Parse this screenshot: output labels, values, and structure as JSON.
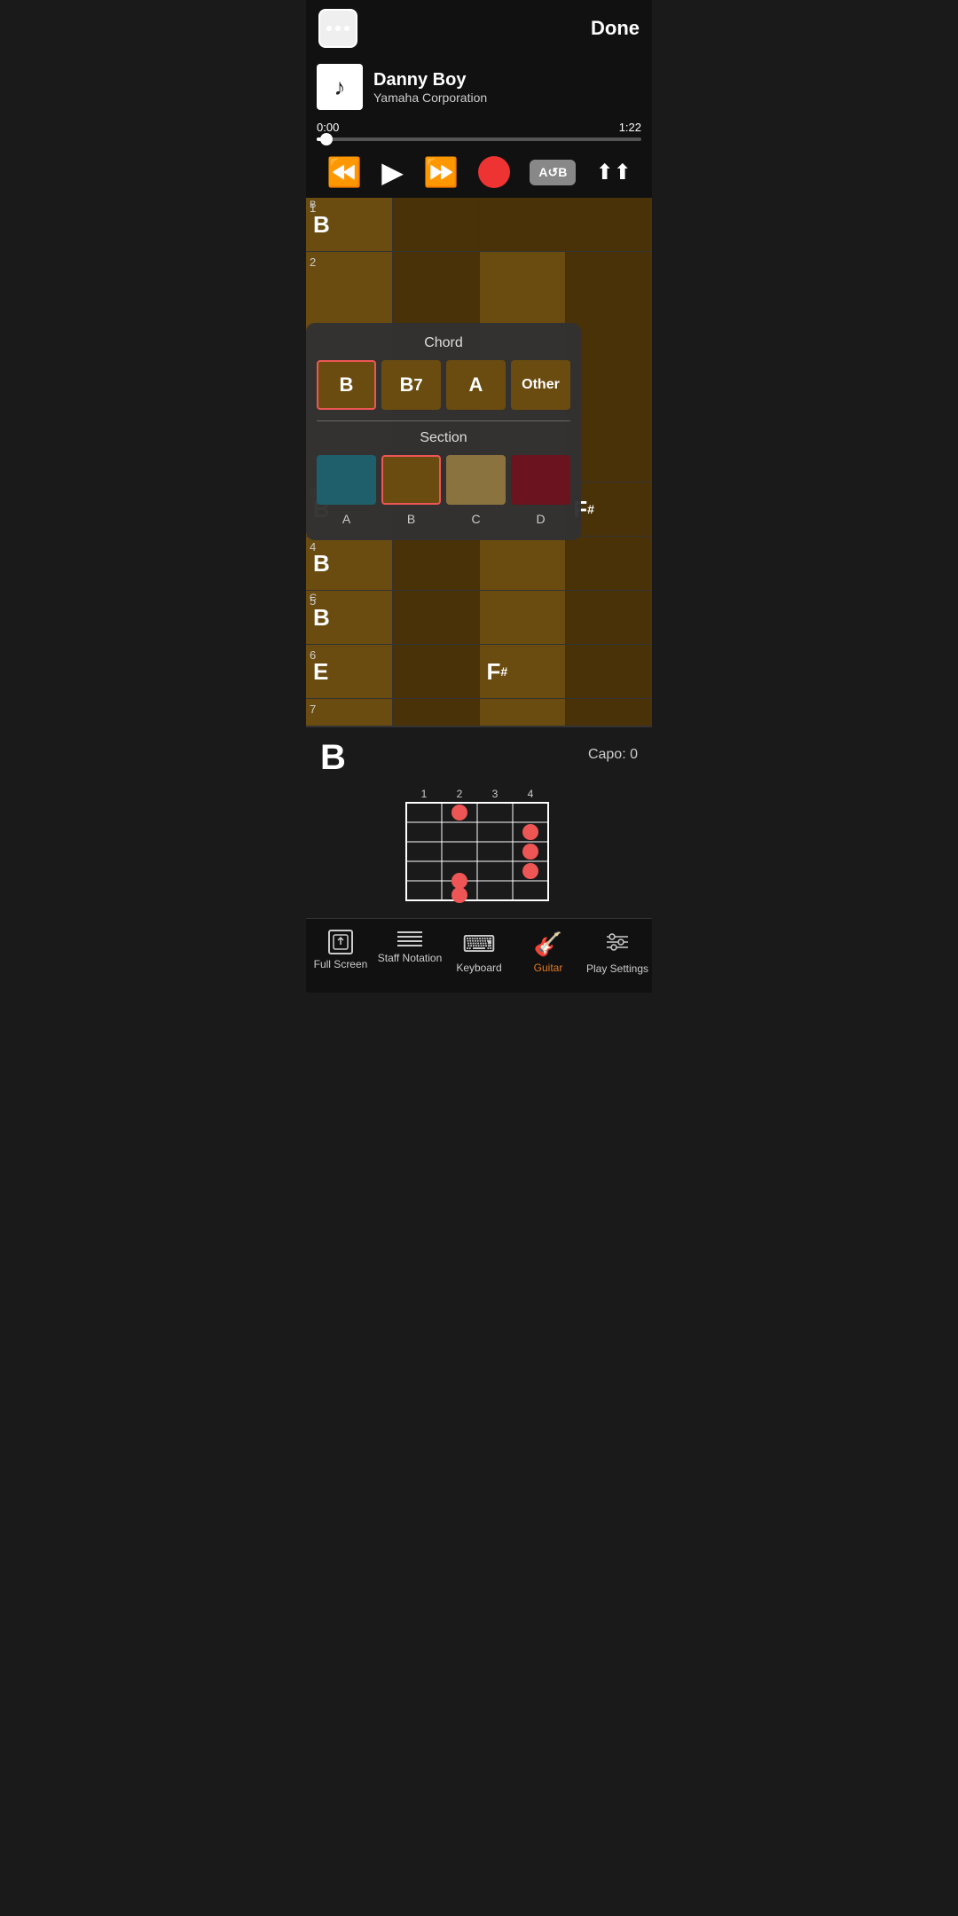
{
  "header": {
    "done_label": "Done",
    "dots_label": "menu"
  },
  "song": {
    "title": "Danny Boy",
    "artist": "Yamaha Corporation",
    "current_time": "0:00",
    "total_time": "1:22",
    "progress_pct": 2
  },
  "transport": {
    "rewind_label": "Rewind",
    "play_label": "Play",
    "ffwd_label": "Fast Forward",
    "record_label": "Record",
    "ab_label": "A↺B",
    "queue_label": "Queue"
  },
  "measures": [
    {
      "num": "1",
      "cells": [
        {
          "note": "B",
          "tag": "B",
          "variant": "normal"
        },
        {
          "note": "",
          "tag": "",
          "variant": "dark"
        },
        {
          "note": "",
          "tag": "",
          "variant": "dark"
        },
        {
          "note": "",
          "tag": "",
          "variant": "dark"
        }
      ]
    },
    {
      "num": "2",
      "cells": [
        {
          "note": "",
          "tag": "",
          "variant": "normal"
        },
        {
          "note": "",
          "tag": "",
          "variant": "dark"
        },
        {
          "note": "",
          "tag": "",
          "variant": "normal"
        },
        {
          "note": "",
          "tag": "",
          "variant": "dark"
        }
      ]
    },
    {
      "num": "3",
      "cells": [
        {
          "note": "B",
          "tag": "",
          "variant": "normal"
        },
        {
          "note": "",
          "tag": "",
          "variant": "dark"
        },
        {
          "note": "",
          "tag": "",
          "variant": "normal"
        },
        {
          "note": "F♯",
          "tag": "",
          "variant": "dark"
        }
      ]
    },
    {
      "num": "4",
      "cells": [
        {
          "note": "B",
          "tag": "",
          "variant": "normal"
        },
        {
          "note": "",
          "tag": "",
          "variant": "dark"
        },
        {
          "note": "",
          "tag": "",
          "variant": "normal"
        },
        {
          "note": "",
          "tag": "",
          "variant": "dark"
        }
      ]
    },
    {
      "num": "5",
      "cells": [
        {
          "note": "B",
          "tag": "C",
          "variant": "normal"
        },
        {
          "note": "",
          "tag": "",
          "variant": "dark"
        },
        {
          "note": "",
          "tag": "",
          "variant": "normal"
        },
        {
          "note": "",
          "tag": "",
          "variant": "dark"
        }
      ]
    },
    {
      "num": "6",
      "cells": [
        {
          "note": "E",
          "tag": "",
          "variant": "normal"
        },
        {
          "note": "",
          "tag": "",
          "variant": "dark"
        },
        {
          "note": "F♯",
          "tag": "",
          "variant": "normal"
        },
        {
          "note": "",
          "tag": "",
          "variant": "dark"
        }
      ]
    },
    {
      "num": "7",
      "cells": [
        {
          "note": "",
          "tag": "",
          "variant": "normal"
        },
        {
          "note": "",
          "tag": "",
          "variant": "dark"
        },
        {
          "note": "",
          "tag": "",
          "variant": "normal"
        },
        {
          "note": "",
          "tag": "",
          "variant": "dark"
        }
      ]
    }
  ],
  "chord_popup": {
    "title": "Chord",
    "options": [
      "B",
      "B7",
      "A",
      "Other"
    ],
    "selected": "B",
    "section_title": "Section",
    "sections": [
      {
        "label": "A",
        "color": "blue"
      },
      {
        "label": "B",
        "color": "brown",
        "selected": true
      },
      {
        "label": "C",
        "color": "tan"
      },
      {
        "label": "D",
        "color": "maroon"
      }
    ]
  },
  "chord_diagram": {
    "chord_name": "B",
    "capo_label": "Capo: 0",
    "fret_numbers": [
      "1",
      "2",
      "3",
      "4"
    ],
    "dots": [
      {
        "string": 2,
        "fret": 2
      },
      {
        "string": 4,
        "fret": 4
      },
      {
        "string": 5,
        "fret": 4
      },
      {
        "string": 6,
        "fret": 4
      },
      {
        "string": 5,
        "fret": 3
      },
      {
        "string": 5,
        "fret": 5
      }
    ]
  },
  "bottom_nav": {
    "items": [
      {
        "label": "Full Screen",
        "icon": "fullscreen-icon",
        "active": false
      },
      {
        "label": "Staff Notation",
        "icon": "staff-icon",
        "active": false
      },
      {
        "label": "Keyboard",
        "icon": "keyboard-icon",
        "active": false
      },
      {
        "label": "Guitar",
        "icon": "guitar-icon",
        "active": true
      },
      {
        "label": "Play Settings",
        "icon": "settings-icon",
        "active": false
      }
    ]
  }
}
